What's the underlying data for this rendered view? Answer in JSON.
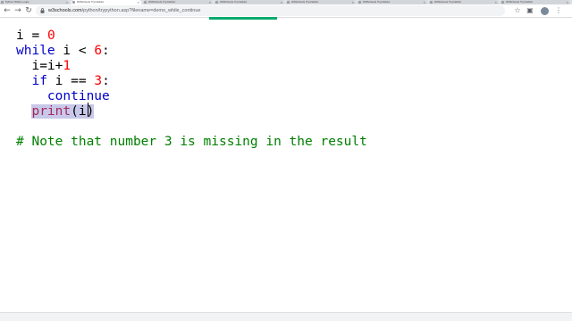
{
  "browser": {
    "tabs": [
      {
        "label": "Python While Loops",
        "active": false
      },
      {
        "label": "W3Schools Tryit Editor",
        "active": true
      },
      {
        "label": "W3Schools Tryit Editor",
        "active": false
      },
      {
        "label": "W3Schools Tryit Editor",
        "active": false
      },
      {
        "label": "W3Schools Tryit Editor",
        "active": false
      },
      {
        "label": "W3Schools Tryit Editor",
        "active": false
      },
      {
        "label": "W3Schools Tryit Editor",
        "active": false
      },
      {
        "label": "W3Schools Tryit Editor",
        "active": false
      }
    ],
    "nav": {
      "back_icon": "arrow-left-icon",
      "forward_icon": "arrow-right-icon",
      "reload_icon": "reload-icon"
    },
    "address": {
      "host": "w3schools.com",
      "path": "/python/trypython.asp?filename=demo_while_continue"
    },
    "toolbar_icons": [
      "star-icon",
      "extension-icon",
      "puzzle-icon",
      "menu-icon"
    ],
    "accent_color": "#04aa6d"
  },
  "editor": {
    "lines": {
      "l1": {
        "var": "i",
        "eq": " = ",
        "num": "0"
      },
      "l2": {
        "kw": "while",
        "rest": " i < ",
        "num": "6",
        "colon": ":"
      },
      "l3": {
        "indent": "  ",
        "text": "i=i+",
        "num": "1"
      },
      "l4": {
        "indent": "  ",
        "kw": "if",
        "rest": " i == ",
        "num": "3",
        "colon": ":"
      },
      "l5": {
        "indent": "    ",
        "kw": "continue"
      },
      "l6": {
        "indent": "  ",
        "builtin": "print",
        "args": "(i)"
      },
      "l7": {
        "text": ""
      },
      "l8": {
        "comment": "# Note that number 3 is missing in the result"
      }
    },
    "colors": {
      "keyword": "#0000cd",
      "number": "#ff0000",
      "comment": "#008000",
      "builtin": "#a52a5a",
      "selection": "#c8c8ea"
    }
  }
}
